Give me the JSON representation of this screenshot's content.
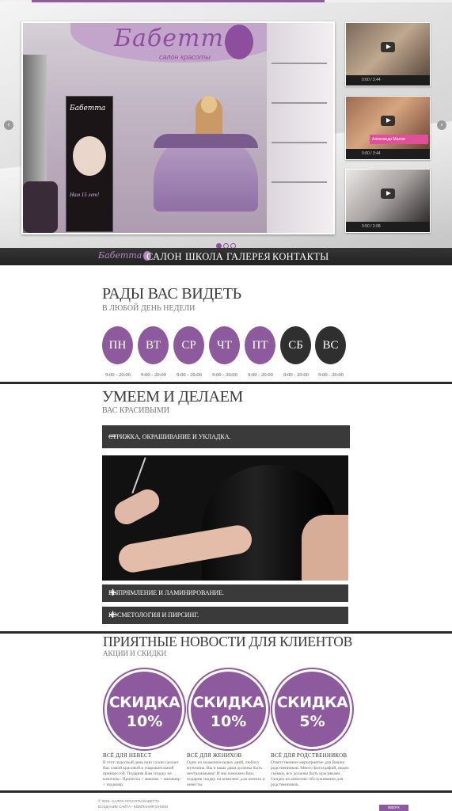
{
  "colors": {
    "accent": "#8e5a9e",
    "dark_bar": "#2a2a2a",
    "weekend": "#2f2f2f"
  },
  "hero": {
    "logo_text": "Бабетта",
    "logo_subtitle": "салон красоты",
    "poster_brand": "Бабетта",
    "poster_caption": "Нам 15 лет!",
    "videos": [
      {
        "time": "0:00 / 3:44"
      },
      {
        "time": "0:00 / 3:44",
        "caption": "Александр Малов"
      },
      {
        "time": "0:00 / 2:08"
      }
    ],
    "prev_icon": "chevron-left-icon",
    "next_icon": "chevron-right-icon",
    "slides": 3,
    "active_slide": 1
  },
  "nav": {
    "logo": "Бабетта",
    "items": [
      "САЛОН",
      "ШКОЛА",
      "ГАЛЕРЕЯ",
      "КОНТАКТЫ"
    ]
  },
  "welcome": {
    "title": "РАДЫ ВАС ВИДЕТЬ",
    "subtitle": "В ЛЮБОЙ ДЕНЬ НЕДЕЛИ",
    "days": [
      {
        "label": "ПН",
        "hours": "9:00 - 20:00"
      },
      {
        "label": "ВТ",
        "hours": "9:00 - 20:00"
      },
      {
        "label": "СР",
        "hours": "9:00 - 20:00"
      },
      {
        "label": "ЧТ",
        "hours": "9:00 - 20:00"
      },
      {
        "label": "ПТ",
        "hours": "9:00 - 20:00"
      },
      {
        "label": "СБ",
        "hours": "9:00 - 20:00"
      },
      {
        "label": "ВС",
        "hours": "9:00 - 20:00"
      }
    ]
  },
  "services": {
    "title": "УМЕЕМ И ДЕЛАЕМ",
    "subtitle": "ВАС КРАСИВЫМИ",
    "items": [
      {
        "label": "СТРИЖКА, ОКРАШИВАНИЕ И УКЛАДКА.",
        "sign": "−"
      },
      {
        "label": "ВЫПРЯМЛЕНИЕ И ЛАМИНИРОВАНИЕ.",
        "sign": "+"
      },
      {
        "label": "КОСМЕТОЛОГИЯ И ПИРСИНГ.",
        "sign": "+"
      }
    ]
  },
  "news": {
    "title": "ПРИЯТНЫЕ НОВОСТИ ДЛЯ КЛИЕНТОВ",
    "subtitle": "АКЦИИ И СКИДКИ",
    "cards": [
      {
        "badge_word": "СКИДКА",
        "badge_value": "10%",
        "heading": "ВСЁ ДЛЯ НЕВЕСТ",
        "text": "В этот чудесный день наш салон сделает Вас самой красивой и очаровательной принцессой. Подарим Вам скидку на комплекс: Прическа + макияж + маникюр + педикюр."
      },
      {
        "badge_word": "СКИДКА",
        "badge_value": "10%",
        "heading": "ВСЁ ДЛЯ ЖЕНИХОВ",
        "text": "Одно из знаменательных дней, любого мужчины. Вы и ваша дама должны быть неотразимыми! И мы поможем Вам, подарив скидку на комплекс для жениха и невесты."
      },
      {
        "badge_word": "СКИДКА",
        "badge_value": "5%",
        "heading": "ВСЁ ДЛЯ РОДСТВЕННИКОВ",
        "text": "Ответственное мероприятие для Ваших родственников. Много фотографий, видео съёмки, все должны быть красивыми. Скидка на комплекс обслуживания для родственников."
      }
    ]
  },
  "footer": {
    "copyright": "© 2024. САЛОН КРАСОТЫ БАБЕТТА",
    "credits": "СОЗДАНИЕ САЙТА - КОМПАНИЯ ОНЭКО",
    "up_button": "ВВЕРХ"
  }
}
